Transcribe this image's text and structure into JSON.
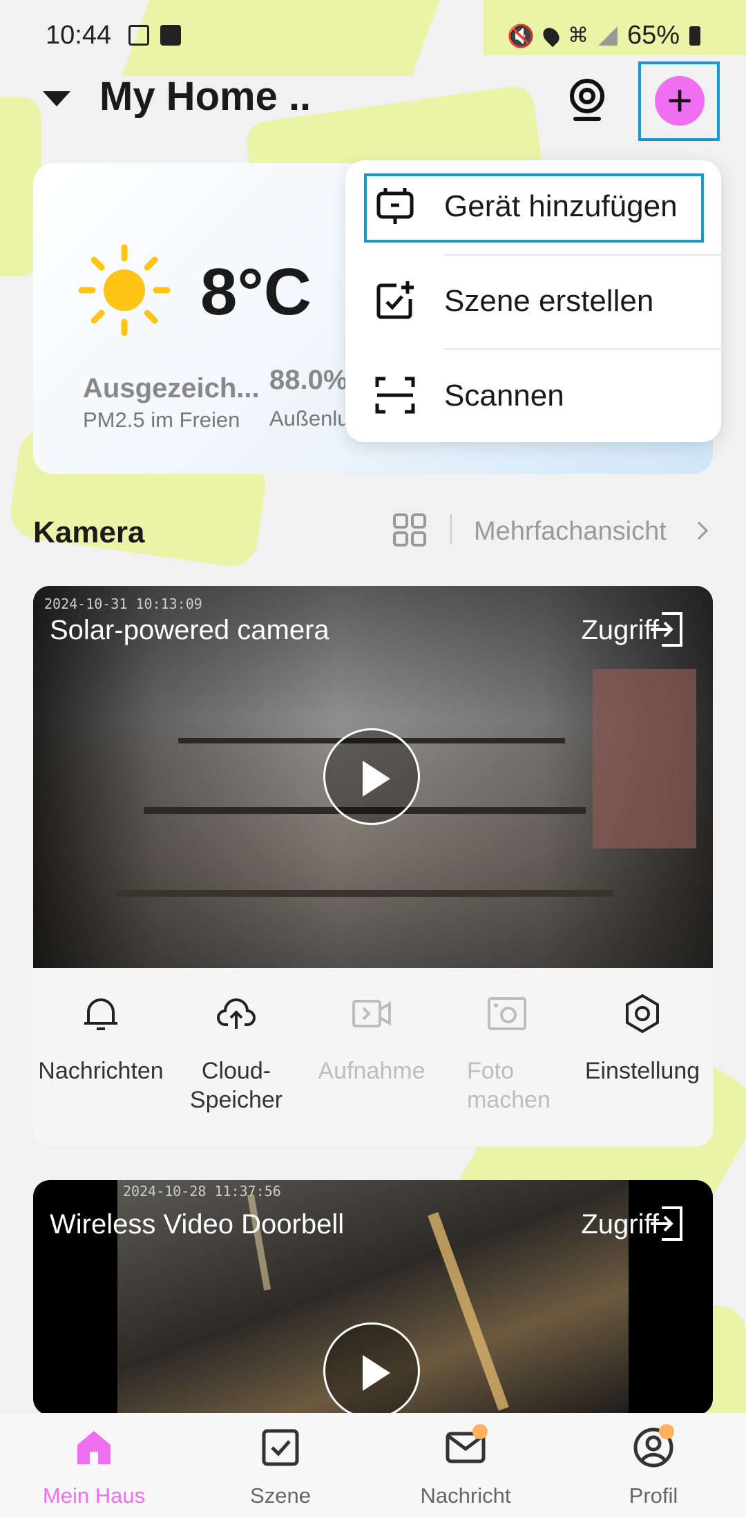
{
  "status_bar": {
    "time": "10:44",
    "battery": "65%"
  },
  "header": {
    "home_name": "My Home ..",
    "add_symbol": "+"
  },
  "weather": {
    "temperature": "8°C",
    "air_quality": "Ausgezeich...",
    "air_quality_label": "PM2.5 im Freien",
    "humidity": "88.0%",
    "humidity_label": "Außenluftfeuchtigkeit"
  },
  "add_menu": {
    "items": [
      {
        "label": "Gerät hinzufügen",
        "icon": "add-device-icon"
      },
      {
        "label": "Szene erstellen",
        "icon": "create-scene-icon"
      },
      {
        "label": "Scannen",
        "icon": "scan-icon"
      }
    ]
  },
  "camera_section": {
    "title": "Kamera",
    "multi_view": "Mehrfachansicht"
  },
  "cameras": [
    {
      "name": "Solar-powered camera",
      "access": "Zugriff",
      "timestamp": "2024-10-31 10:13:09",
      "actions": [
        {
          "label": "Nachrichten",
          "icon": "bell-icon",
          "enabled": true
        },
        {
          "label": "Cloud-Speicher",
          "icon": "cloud-upload-icon",
          "enabled": true
        },
        {
          "label": "Aufnahme",
          "icon": "record-video-icon",
          "enabled": false
        },
        {
          "label": "Foto machen",
          "icon": "take-photo-icon",
          "enabled": false
        },
        {
          "label": "Einstellung",
          "icon": "settings-icon",
          "enabled": true
        }
      ]
    },
    {
      "name": "Wireless Video Doorbell",
      "access": "Zugriff",
      "timestamp": "2024-10-28 11:37:56"
    }
  ],
  "bottom_nav": [
    {
      "label": "Mein Haus",
      "icon": "home-icon",
      "active": true
    },
    {
      "label": "Szene",
      "icon": "scene-icon",
      "active": false
    },
    {
      "label": "Nachricht",
      "icon": "message-icon",
      "active": false
    },
    {
      "label": "Profil",
      "icon": "profile-icon",
      "active": false
    }
  ],
  "colors": {
    "accent": "#f06ef0",
    "highlight_frame": "#1598d4",
    "badge": "#ffb15c"
  }
}
